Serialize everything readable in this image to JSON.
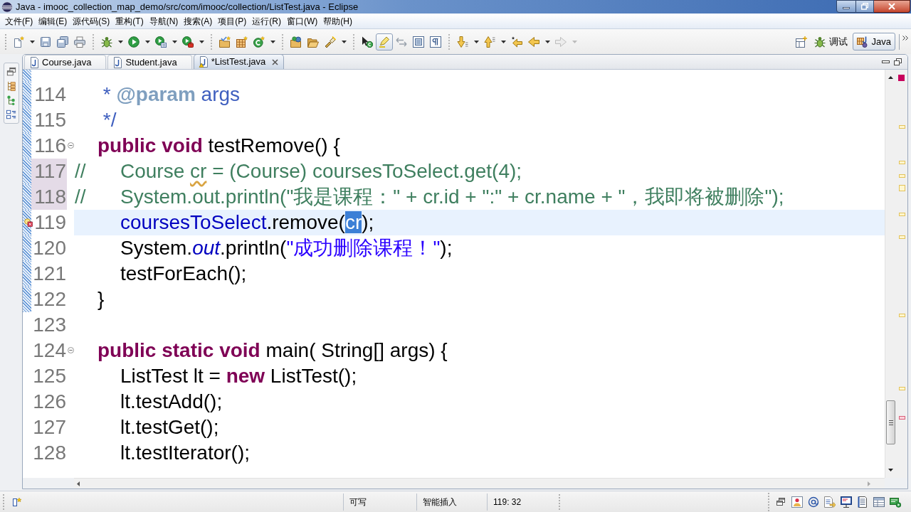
{
  "window": {
    "title": "Java - imooc_collection_map_demo/src/com/imooc/collection/ListTest.java - Eclipse"
  },
  "menu": [
    "文件(F)",
    "编辑(E)",
    "源代码(S)",
    "重构(T)",
    "导航(N)",
    "搜索(A)",
    "项目(P)",
    "运行(R)",
    "窗口(W)",
    "帮助(H)"
  ],
  "toolbar": {
    "highlight_toggle_pressed": true,
    "forward_enabled": false
  },
  "perspectives": [
    {
      "kind": "debug",
      "label": "调试",
      "selected": false
    },
    {
      "kind": "java",
      "label": "Java",
      "selected": true
    }
  ],
  "editor_tabs": [
    {
      "label": "Course.java",
      "selected": false,
      "warning": false
    },
    {
      "label": "Student.java",
      "selected": false,
      "warning": false
    },
    {
      "label": "*ListTest.java",
      "selected": true,
      "warning": true
    }
  ],
  "editor": {
    "lines": [
      {
        "number": "114",
        "in_range": true,
        "changed": false,
        "current": false,
        "foldable": false,
        "error_marker": false,
        "tokens": [
          {
            "kind": "javadoc",
            "text": "\t * "
          },
          {
            "kind": "javadoc_tag",
            "text": "@param"
          },
          {
            "kind": "javadoc",
            "text": " args"
          }
        ]
      },
      {
        "number": "115",
        "in_range": true,
        "changed": false,
        "current": false,
        "foldable": false,
        "error_marker": false,
        "tokens": [
          {
            "kind": "javadoc",
            "text": "\t */"
          }
        ]
      },
      {
        "number": "116",
        "in_range": true,
        "changed": false,
        "current": false,
        "foldable": true,
        "error_marker": false,
        "tokens": [
          {
            "kind": "keyword",
            "text": "\tpublic void"
          },
          {
            "kind": "plain",
            "text": " testRemove() {"
          }
        ]
      },
      {
        "number": "117",
        "in_range": true,
        "changed": true,
        "current": false,
        "foldable": false,
        "error_marker": false,
        "tokens": [
          {
            "kind": "comment",
            "text": "//\t\tCourse "
          },
          {
            "kind": "comment_flagged",
            "text": "cr"
          },
          {
            "kind": "comment",
            "text": " = (Course) coursesToSelect.get(4);"
          }
        ]
      },
      {
        "number": "118",
        "in_range": true,
        "changed": true,
        "current": false,
        "foldable": false,
        "error_marker": false,
        "tokens": [
          {
            "kind": "comment",
            "text": "//\t\tSystem.out.println(\"我是课程：\" + cr.id + \":\" + cr.name + \"，我即将被删除\");"
          }
        ]
      },
      {
        "number": "119",
        "in_range": true,
        "changed": false,
        "current": true,
        "foldable": false,
        "error_marker": true,
        "tokens": [
          {
            "kind": "field",
            "text": "\t\tcoursesToSelect"
          },
          {
            "kind": "plain",
            "text": ".remove("
          },
          {
            "kind": "selected",
            "text": "cr"
          },
          {
            "kind": "plain",
            "text": ");"
          }
        ]
      },
      {
        "number": "120",
        "in_range": true,
        "changed": false,
        "current": false,
        "foldable": false,
        "error_marker": false,
        "tokens": [
          {
            "kind": "plain",
            "text": "\t\tSystem."
          },
          {
            "kind": "static_field",
            "text": "out"
          },
          {
            "kind": "plain",
            "text": ".println("
          },
          {
            "kind": "string",
            "text": "\"成功删除课程！\""
          },
          {
            "kind": "plain",
            "text": ");"
          }
        ]
      },
      {
        "number": "121",
        "in_range": true,
        "changed": false,
        "current": false,
        "foldable": false,
        "error_marker": false,
        "tokens": [
          {
            "kind": "plain",
            "text": "\t\ttestForEach();"
          }
        ]
      },
      {
        "number": "122",
        "in_range": true,
        "changed": false,
        "current": false,
        "foldable": false,
        "error_marker": false,
        "tokens": [
          {
            "kind": "plain",
            "text": "\t}"
          }
        ]
      },
      {
        "number": "123",
        "in_range": false,
        "changed": false,
        "current": false,
        "foldable": false,
        "error_marker": false
      },
      {
        "number": "124",
        "in_range": false,
        "changed": false,
        "current": false,
        "foldable": true,
        "error_marker": false,
        "tokens": [
          {
            "kind": "keyword",
            "text": "\tpublic static void"
          },
          {
            "kind": "plain",
            "text": " main( String[] args) {"
          }
        ]
      },
      {
        "number": "125",
        "in_range": false,
        "changed": false,
        "current": false,
        "foldable": false,
        "error_marker": false,
        "tokens": [
          {
            "kind": "plain",
            "text": "\t\tListTest lt = "
          },
          {
            "kind": "keyword",
            "text": "new"
          },
          {
            "kind": "plain",
            "text": " ListTest();"
          }
        ]
      },
      {
        "number": "126",
        "in_range": false,
        "changed": false,
        "current": false,
        "foldable": false,
        "error_marker": false,
        "tokens": [
          {
            "kind": "plain",
            "text": "\t\tlt.testAdd();"
          }
        ]
      },
      {
        "number": "127",
        "in_range": false,
        "changed": false,
        "current": false,
        "foldable": false,
        "error_marker": false,
        "tokens": [
          {
            "kind": "plain",
            "text": "\t\tlt.testGet();"
          }
        ]
      },
      {
        "number": "128",
        "in_range": false,
        "changed": false,
        "current": false,
        "foldable": false,
        "error_marker": false,
        "tokens": [
          {
            "kind": "plain",
            "text": "\t\tlt.testIterator();"
          }
        ]
      }
    ]
  },
  "status_bar": {
    "fields": [
      "可写",
      "智能插入",
      "119: 32"
    ]
  }
}
